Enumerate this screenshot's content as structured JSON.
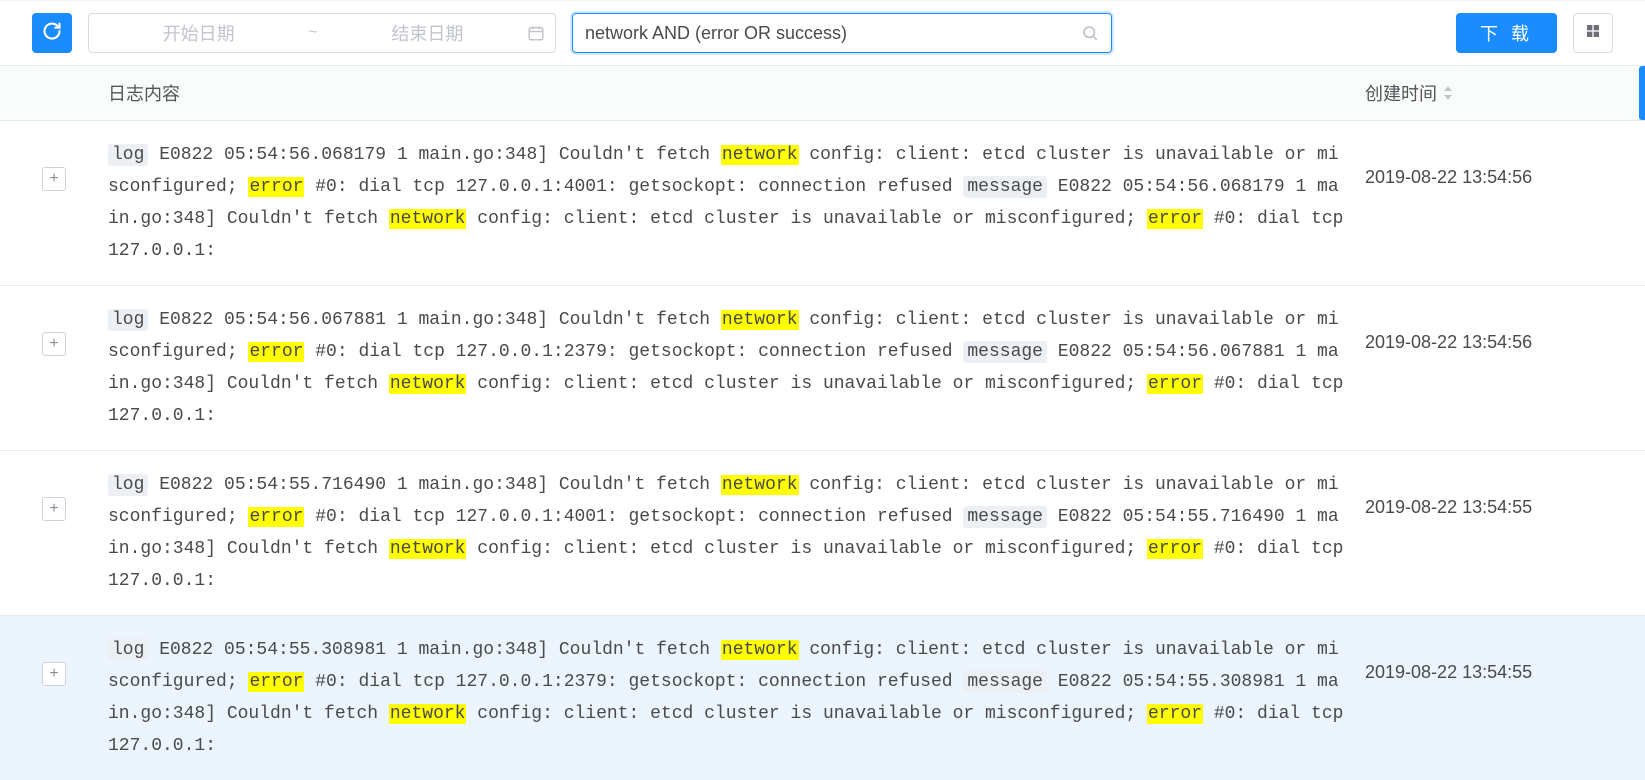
{
  "toolbar": {
    "start_date_placeholder": "开始日期",
    "end_date_placeholder": "结束日期",
    "tilde": "~",
    "search_value": "network AND (error OR success)",
    "download_label": "下 载"
  },
  "table": {
    "header_content": "日志内容",
    "header_time": "创建时间",
    "rows": [
      {
        "tokens": [
          {
            "t": "tag",
            "v": "log"
          },
          {
            "t": "txt",
            "v": " E0822 05:54:56.068179 1 main.go:348] Couldn't fetch "
          },
          {
            "t": "hl",
            "v": "network"
          },
          {
            "t": "txt",
            "v": " config: client: etcd cluster is unavailable or misconfigured; "
          },
          {
            "t": "hl",
            "v": "error"
          },
          {
            "t": "txt",
            "v": " #0: dial tcp 127.0.0.1:4001: getsockopt: connection refused "
          },
          {
            "t": "tag",
            "v": "message"
          },
          {
            "t": "txt",
            "v": " E0822 05:54:56.068179 1 main.go:348] Couldn't fetch "
          },
          {
            "t": "hl",
            "v": "network"
          },
          {
            "t": "txt",
            "v": " config: client: etcd cluster is unavailable or misconfigured; "
          },
          {
            "t": "hl",
            "v": "error"
          },
          {
            "t": "txt",
            "v": " #0: dial tcp 127.0.0.1:"
          }
        ],
        "time": "2019-08-22 13:54:56",
        "hovered": false
      },
      {
        "tokens": [
          {
            "t": "tag",
            "v": "log"
          },
          {
            "t": "txt",
            "v": " E0822 05:54:56.067881 1 main.go:348] Couldn't fetch "
          },
          {
            "t": "hl",
            "v": "network"
          },
          {
            "t": "txt",
            "v": " config: client: etcd cluster is unavailable or misconfigured; "
          },
          {
            "t": "hl",
            "v": "error"
          },
          {
            "t": "txt",
            "v": " #0: dial tcp 127.0.0.1:2379: getsockopt: connection refused "
          },
          {
            "t": "tag",
            "v": "message"
          },
          {
            "t": "txt",
            "v": " E0822 05:54:56.067881 1 main.go:348] Couldn't fetch "
          },
          {
            "t": "hl",
            "v": "network"
          },
          {
            "t": "txt",
            "v": " config: client: etcd cluster is unavailable or misconfigured; "
          },
          {
            "t": "hl",
            "v": "error"
          },
          {
            "t": "txt",
            "v": " #0: dial tcp 127.0.0.1:"
          }
        ],
        "time": "2019-08-22 13:54:56",
        "hovered": false
      },
      {
        "tokens": [
          {
            "t": "tag",
            "v": "log"
          },
          {
            "t": "txt",
            "v": " E0822 05:54:55.716490 1 main.go:348] Couldn't fetch "
          },
          {
            "t": "hl",
            "v": "network"
          },
          {
            "t": "txt",
            "v": " config: client: etcd cluster is unavailable or misconfigured; "
          },
          {
            "t": "hl",
            "v": "error"
          },
          {
            "t": "txt",
            "v": " #0: dial tcp 127.0.0.1:4001: getsockopt: connection refused "
          },
          {
            "t": "tag",
            "v": "message"
          },
          {
            "t": "txt",
            "v": " E0822 05:54:55.716490 1 main.go:348] Couldn't fetch "
          },
          {
            "t": "hl",
            "v": "network"
          },
          {
            "t": "txt",
            "v": " config: client: etcd cluster is unavailable or misconfigured; "
          },
          {
            "t": "hl",
            "v": "error"
          },
          {
            "t": "txt",
            "v": " #0: dial tcp 127.0.0.1:"
          }
        ],
        "time": "2019-08-22 13:54:55",
        "hovered": false
      },
      {
        "tokens": [
          {
            "t": "tag",
            "v": "log"
          },
          {
            "t": "txt",
            "v": " E0822 05:54:55.308981 1 main.go:348] Couldn't fetch "
          },
          {
            "t": "hl",
            "v": "network"
          },
          {
            "t": "txt",
            "v": " config: client: etcd cluster is unavailable or misconfigured; "
          },
          {
            "t": "hl",
            "v": "error"
          },
          {
            "t": "txt",
            "v": " #0: dial tcp 127.0.0.1:2379: getsockopt: connection refused "
          },
          {
            "t": "tag",
            "v": "message"
          },
          {
            "t": "txt",
            "v": " E0822 05:54:55.308981 1 main.go:348] Couldn't fetch "
          },
          {
            "t": "hl",
            "v": "network"
          },
          {
            "t": "txt",
            "v": " config: client: etcd cluster is unavailable or misconfigured; "
          },
          {
            "t": "hl",
            "v": "error"
          },
          {
            "t": "txt",
            "v": " #0: dial tcp 127.0.0.1:"
          }
        ],
        "time": "2019-08-22 13:54:55",
        "hovered": true
      }
    ]
  }
}
